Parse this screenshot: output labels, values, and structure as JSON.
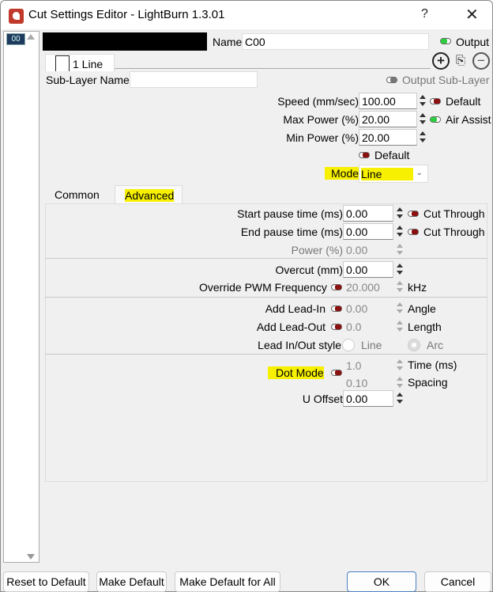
{
  "window": {
    "title": "Cut Settings Editor - LightBurn 1.3.01",
    "help": "?",
    "close": "✕"
  },
  "layers": [
    {
      "label": "00",
      "color": "#1f3a5f"
    }
  ],
  "header": {
    "name_label": "Name",
    "name_value": "C00",
    "output_label": "Output",
    "output_on": true
  },
  "sublayer": {
    "tab_label": "1 Line",
    "name_label": "Sub-Layer Name",
    "name_value": "",
    "output_label": "Output Sub-Layer",
    "add_icon": "plus-circle-icon",
    "copy_icon": "copy-icon",
    "remove_icon": "minus-circle-icon"
  },
  "main": {
    "speed": {
      "label": "Speed (mm/sec)",
      "value": "100.00",
      "toggle_label": "Default",
      "toggle_on": false
    },
    "max_power": {
      "label": "Max Power (%)",
      "value": "20.00",
      "toggle_label": "Air Assist",
      "toggle_on": true
    },
    "min_power": {
      "label": "Min Power (%)",
      "value": "20.00"
    },
    "default_toggle": {
      "label": "Default",
      "on": false
    },
    "mode": {
      "label": "Mode",
      "value": "Line"
    }
  },
  "tabs": [
    {
      "label": "Common",
      "active": false
    },
    {
      "label": "Advanced",
      "active": true
    }
  ],
  "advanced": {
    "start_pause": {
      "label": "Start pause time (ms)",
      "value": "0.00",
      "toggle_label": "Cut Through"
    },
    "end_pause": {
      "label": "End pause time (ms)",
      "value": "0.00",
      "toggle_label": "Cut Through"
    },
    "power": {
      "label": "Power (%)",
      "value": "0.00"
    },
    "overcut": {
      "label": "Overcut (mm)",
      "value": "0.00"
    },
    "pwm": {
      "label": "Override PWM Frequency",
      "value": "20.000",
      "unit": "kHz"
    },
    "lead_in": {
      "label": "Add Lead-In",
      "value": "0.00",
      "unit": "Angle"
    },
    "lead_out": {
      "label": "Add Lead-Out",
      "value": "0.0",
      "unit": "Length"
    },
    "lead_style": {
      "label": "Lead In/Out style",
      "options": [
        "Line",
        "Arc"
      ],
      "selected": "Arc"
    },
    "dot_mode": {
      "label": "Dot Mode",
      "time_value": "1.0",
      "time_unit": "Time (ms)",
      "spacing_value": "0.10",
      "spacing_unit": "Spacing"
    },
    "u_offset": {
      "label": "U Offset",
      "value": "0.00"
    }
  },
  "footer": {
    "reset": "Reset to Default",
    "make_default": "Make Default",
    "make_default_all": "Make Default for All",
    "ok": "OK",
    "cancel": "Cancel"
  }
}
